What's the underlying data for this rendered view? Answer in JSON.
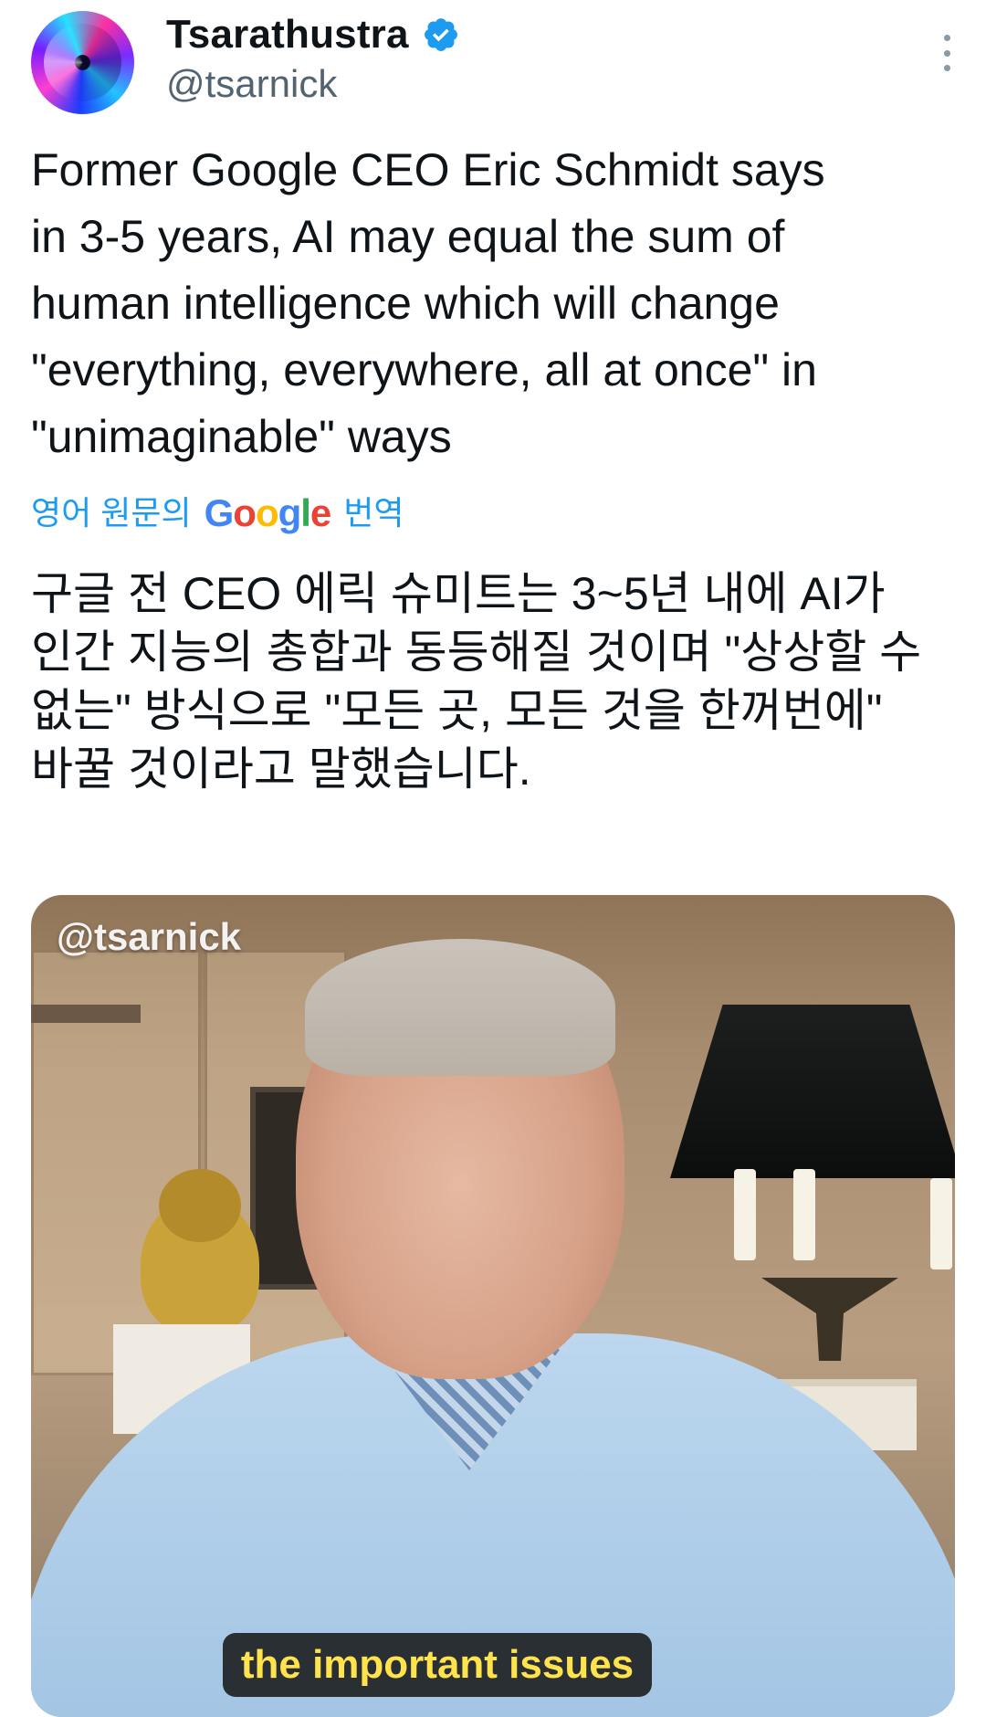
{
  "author": {
    "display_name": "Tsarathustra",
    "handle": "@tsarnick",
    "verified": true,
    "accent_color": "#1d9bf0"
  },
  "icons": {
    "avatar": "avatar-image",
    "verified": "verified-badge-icon",
    "more": "more-options-icon"
  },
  "tweet": {
    "text": "Former Google CEO Eric Schmidt says\nin 3-5 years, AI may equal the sum of\nhuman intelligence which will change\n\"everything, everywhere, all at once\" in\n\"unimaginable\" ways"
  },
  "translate_bar": {
    "prefix": "영어 원문의",
    "brand": "Google",
    "suffix": "번역"
  },
  "translated_text": "구글 전 CEO 에릭 슈미트는 3~5년 내에 AI가\n인간 지능의 총합과 동등해질 것이며 \"상상할 수\n없는\" 방식으로 \"모든 곳, 모든 것을 한꺼번에\"\n바꿀 것이라고 말했습니다.",
  "media": {
    "watermark": "@tsarnick",
    "caption": "the important issues"
  }
}
